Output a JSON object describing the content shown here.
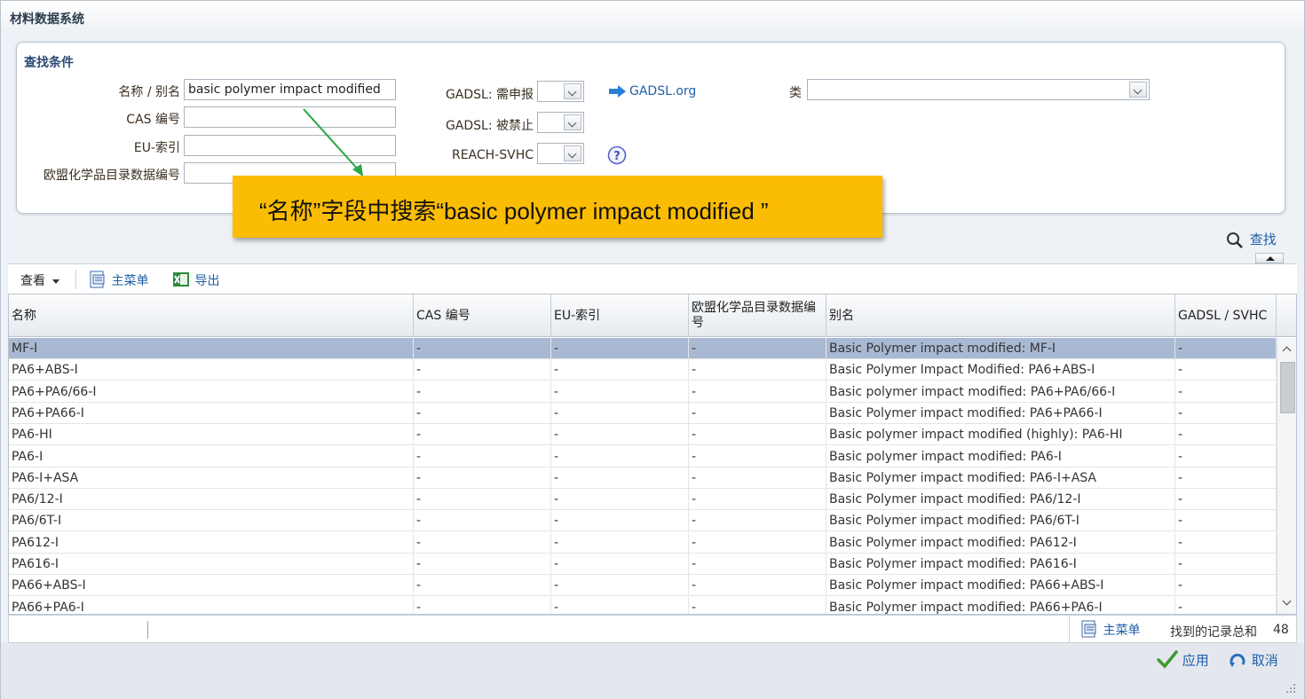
{
  "app": {
    "title": "材料数据系统"
  },
  "search": {
    "header": "查找条件",
    "name_label": "名称 / 别名",
    "name_value": "basic polymer impact modified",
    "cas_label": "CAS 编号",
    "cas_value": "",
    "eu_label": "EU-索引",
    "eu_value": "",
    "ec_label": "欧盟化学品目录数据编号",
    "ec_value": "",
    "gadsl_declare_label": "GADSL: 需申报",
    "gadsl_declare_value": "",
    "gadsl_prohibited_label": "GADSL: 被禁止",
    "gadsl_prohibited_value": "",
    "reach_label": "REACH-SVHC",
    "reach_value": "",
    "gadsl_link": "GADSL.org",
    "class_label": "类",
    "class_value": "",
    "find_label": "查找"
  },
  "callout": {
    "text": "“名称”字段中搜索“basic  polymer impact modified ”"
  },
  "toolbar": {
    "view_label": "查看",
    "main_menu_label": "主菜单",
    "export_label": "导出"
  },
  "table": {
    "columns": [
      "名称",
      "CAS 编号",
      "EU-索引",
      "欧盟化学品目录数据编号",
      "别名",
      "GADSL / SVHC"
    ],
    "rows": [
      [
        "MF-I",
        "-",
        "-",
        "-",
        "Basic Polymer impact modified: MF-I",
        "-"
      ],
      [
        "PA6+ABS-I",
        "-",
        "-",
        "-",
        "Basic Polymer Impact Modified: PA6+ABS-I",
        "-"
      ],
      [
        "PA6+PA6/66-I",
        "-",
        "-",
        "-",
        "Basic polymer impact modified: PA6+PA6/66-I",
        "-"
      ],
      [
        "PA6+PA66-I",
        "-",
        "-",
        "-",
        "Basic Polymer impact modified: PA6+PA66-I",
        "-"
      ],
      [
        "PA6-HI",
        "-",
        "-",
        "-",
        "Basic polymer impact modified (highly): PA6-HI",
        "-"
      ],
      [
        "PA6-I",
        "-",
        "-",
        "-",
        "Basic polymer impact modified: PA6-I",
        "-"
      ],
      [
        "PA6-I+ASA",
        "-",
        "-",
        "-",
        "Basic Polymer impact modified: PA6-I+ASA",
        "-"
      ],
      [
        "PA6/12-I",
        "-",
        "-",
        "-",
        "Basic Polymer impact modified: PA6/12-I",
        "-"
      ],
      [
        "PA6/6T-I",
        "-",
        "-",
        "-",
        "Basic Polymer impact modified: PA6/6T-I",
        "-"
      ],
      [
        "PA612-I",
        "-",
        "-",
        "-",
        "Basic Polymer impact modified: PA612-I",
        "-"
      ],
      [
        "PA616-I",
        "-",
        "-",
        "-",
        "Basic Polymer impact modified: PA616-I",
        "-"
      ],
      [
        "PA66+ABS-I",
        "-",
        "-",
        "-",
        "Basic Polymer impact modified: PA66+ABS-I",
        "-"
      ],
      [
        "PA66+PA6-I",
        "-",
        "-",
        "-",
        "Basic Polymer impact modified: PA66+PA6-I",
        "-"
      ]
    ]
  },
  "status": {
    "main_menu_label": "主菜单",
    "records_label": "找到的记录总和",
    "records_count": "48"
  },
  "footer": {
    "apply_label": "应用",
    "cancel_label": "取消"
  },
  "colors": {
    "accent": "#1f5fa8",
    "selected_row": "#a9b9d3",
    "callout": "#fbbc04",
    "apply_check": "#3c9a2e"
  }
}
